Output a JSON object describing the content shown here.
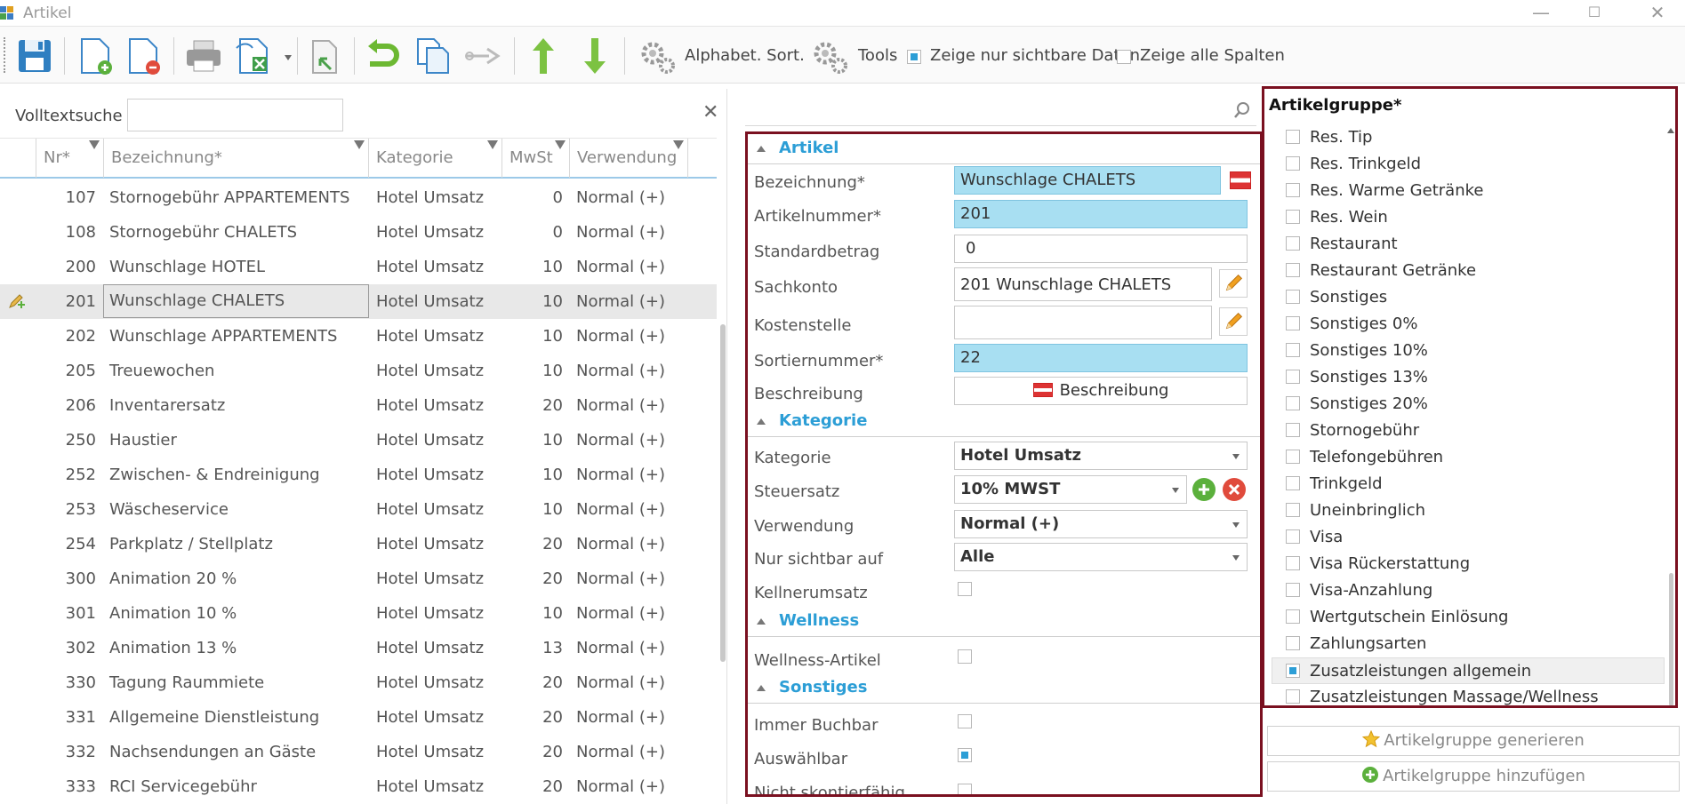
{
  "window": {
    "title": "Artikel"
  },
  "toolbar": {
    "alpha_sort": "Alphabet. Sort.",
    "tools": "Tools",
    "visible_only": "Zeige nur sichtbare Daten",
    "all_columns": "Zeige alle Spalten"
  },
  "list": {
    "search_label": "Volltextsuche",
    "search_value": "",
    "columns": [
      "Nr*",
      "Bezeichnung*",
      "Kategorie",
      "MwSt",
      "Verwendung"
    ],
    "rows": [
      {
        "nr": "107",
        "bez": "Stornogebühr APPARTEMENTS",
        "kat": "Hotel Umsatz",
        "mwst": "0",
        "verw": "Normal (+)"
      },
      {
        "nr": "108",
        "bez": "Stornogebühr CHALETS",
        "kat": "Hotel Umsatz",
        "mwst": "0",
        "verw": "Normal (+)"
      },
      {
        "nr": "200",
        "bez": "Wunschlage HOTEL",
        "kat": "Hotel Umsatz",
        "mwst": "10",
        "verw": "Normal (+)"
      },
      {
        "nr": "201",
        "bez": "Wunschlage CHALETS",
        "kat": "Hotel Umsatz",
        "mwst": "10",
        "verw": "Normal (+)"
      },
      {
        "nr": "202",
        "bez": "Wunschlage APPARTEMENTS",
        "kat": "Hotel Umsatz",
        "mwst": "10",
        "verw": "Normal (+)"
      },
      {
        "nr": "205",
        "bez": "Treuewochen",
        "kat": "Hotel Umsatz",
        "mwst": "10",
        "verw": "Normal (+)"
      },
      {
        "nr": "206",
        "bez": "Inventarersatz",
        "kat": "Hotel Umsatz",
        "mwst": "20",
        "verw": "Normal (+)"
      },
      {
        "nr": "250",
        "bez": "Haustier",
        "kat": "Hotel Umsatz",
        "mwst": "10",
        "verw": "Normal (+)"
      },
      {
        "nr": "252",
        "bez": "Zwischen- & Endreinigung",
        "kat": "Hotel Umsatz",
        "mwst": "10",
        "verw": "Normal (+)"
      },
      {
        "nr": "253",
        "bez": "Wäscheservice",
        "kat": "Hotel Umsatz",
        "mwst": "10",
        "verw": "Normal (+)"
      },
      {
        "nr": "254",
        "bez": "Parkplatz / Stellplatz",
        "kat": "Hotel Umsatz",
        "mwst": "20",
        "verw": "Normal (+)"
      },
      {
        "nr": "300",
        "bez": "Animation 20 %",
        "kat": "Hotel Umsatz",
        "mwst": "20",
        "verw": "Normal (+)"
      },
      {
        "nr": "301",
        "bez": "Animation 10 %",
        "kat": "Hotel Umsatz",
        "mwst": "10",
        "verw": "Normal (+)"
      },
      {
        "nr": "302",
        "bez": "Animation 13 %",
        "kat": "Hotel Umsatz",
        "mwst": "13",
        "verw": "Normal (+)"
      },
      {
        "nr": "330",
        "bez": "Tagung Raummiete",
        "kat": "Hotel Umsatz",
        "mwst": "20",
        "verw": "Normal (+)"
      },
      {
        "nr": "331",
        "bez": "Allgemeine Dienstleistung",
        "kat": "Hotel Umsatz",
        "mwst": "20",
        "verw": "Normal (+)"
      },
      {
        "nr": "332",
        "bez": "Nachsendungen an Gäste",
        "kat": "Hotel Umsatz",
        "mwst": "20",
        "verw": "Normal (+)"
      },
      {
        "nr": "333",
        "bez": "RCI Servicegebühr",
        "kat": "Hotel Umsatz",
        "mwst": "20",
        "verw": "Normal (+)"
      }
    ]
  },
  "form": {
    "sections": {
      "artikel": "Artikel",
      "kategorie": "Kategorie",
      "wellness": "Wellness",
      "sonstiges": "Sonstiges"
    },
    "labels": {
      "bezeichnung": "Bezeichnung*",
      "artikelnummer": "Artikelnummer*",
      "standardbetrag": "Standardbetrag",
      "sachkonto": "Sachkonto",
      "kostenstelle": "Kostenstelle",
      "sortiernummer": "Sortiernummer*",
      "beschreibung": "Beschreibung",
      "kategorie": "Kategorie",
      "steuersatz": "Steuersatz",
      "verwendung": "Verwendung",
      "nur_sichtbar": "Nur sichtbar auf",
      "kellnerumsatz": "Kellnerumsatz",
      "wellness_artikel": "Wellness-Artikel",
      "immer_buchbar": "Immer Buchbar",
      "auswaehlbar": "Auswählbar",
      "nicht_skontierfaehig": "Nicht skontierfähig"
    },
    "values": {
      "bezeichnung": "Wunschlage CHALETS",
      "artikelnummer": "201",
      "standardbetrag": "0",
      "sachkonto": "201 Wunschlage CHALETS",
      "kostenstelle": "",
      "sortiernummer": "22",
      "beschreibung_btn": "Beschreibung",
      "kategorie": "Hotel Umsatz",
      "steuersatz": "10% MWST",
      "verwendung": "Normal (+)",
      "nur_sichtbar": "Alle"
    }
  },
  "artikelgruppe": {
    "title": "Artikelgruppe*",
    "items": [
      {
        "label": "Res. Tip",
        "checked": false
      },
      {
        "label": "Res. Trinkgeld",
        "checked": false
      },
      {
        "label": "Res. Warme Getränke",
        "checked": false
      },
      {
        "label": "Res. Wein",
        "checked": false
      },
      {
        "label": "Restaurant",
        "checked": false
      },
      {
        "label": "Restaurant Getränke",
        "checked": false
      },
      {
        "label": "Sonstiges",
        "checked": false
      },
      {
        "label": "Sonstiges 0%",
        "checked": false
      },
      {
        "label": "Sonstiges 10%",
        "checked": false
      },
      {
        "label": "Sonstiges 13%",
        "checked": false
      },
      {
        "label": "Sonstiges 20%",
        "checked": false
      },
      {
        "label": "Stornogebühr",
        "checked": false
      },
      {
        "label": "Telefongebühren",
        "checked": false
      },
      {
        "label": "Trinkgeld",
        "checked": false
      },
      {
        "label": "Uneinbringlich",
        "checked": false
      },
      {
        "label": "Visa",
        "checked": false
      },
      {
        "label": "Visa Rückerstattung",
        "checked": false
      },
      {
        "label": "Visa-Anzahlung",
        "checked": false
      },
      {
        "label": "Wertgutschein Einlösung",
        "checked": false
      },
      {
        "label": "Zahlungsarten",
        "checked": false
      },
      {
        "label": "Zusatzleistungen allgemein",
        "checked": true
      },
      {
        "label": "Zusatzleistungen Massage/Wellness",
        "checked": false
      }
    ],
    "btn_generate": "Artikelgruppe generieren",
    "btn_add": "Artikelgruppe hinzufügen"
  }
}
